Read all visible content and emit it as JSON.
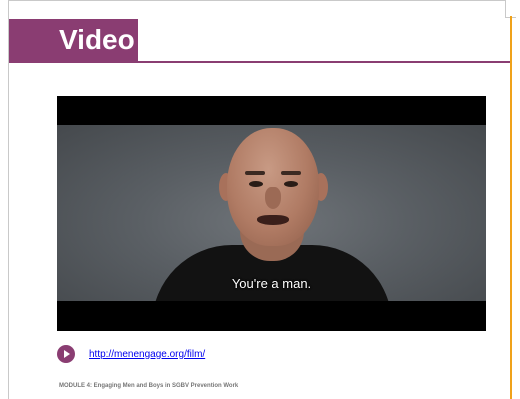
{
  "slide": {
    "title": "Video",
    "link_text": "http://menengage.org/film/",
    "footer": "MODULE 4: Engaging Men and Boys in SGBV Prevention Work"
  },
  "video": {
    "subtitle": "You're a man."
  },
  "colors": {
    "title_bg": "#8a3d72",
    "accent_rule": "#f0a21a",
    "link": "#0000ee"
  },
  "icons": {
    "play": "play-circle-icon"
  }
}
